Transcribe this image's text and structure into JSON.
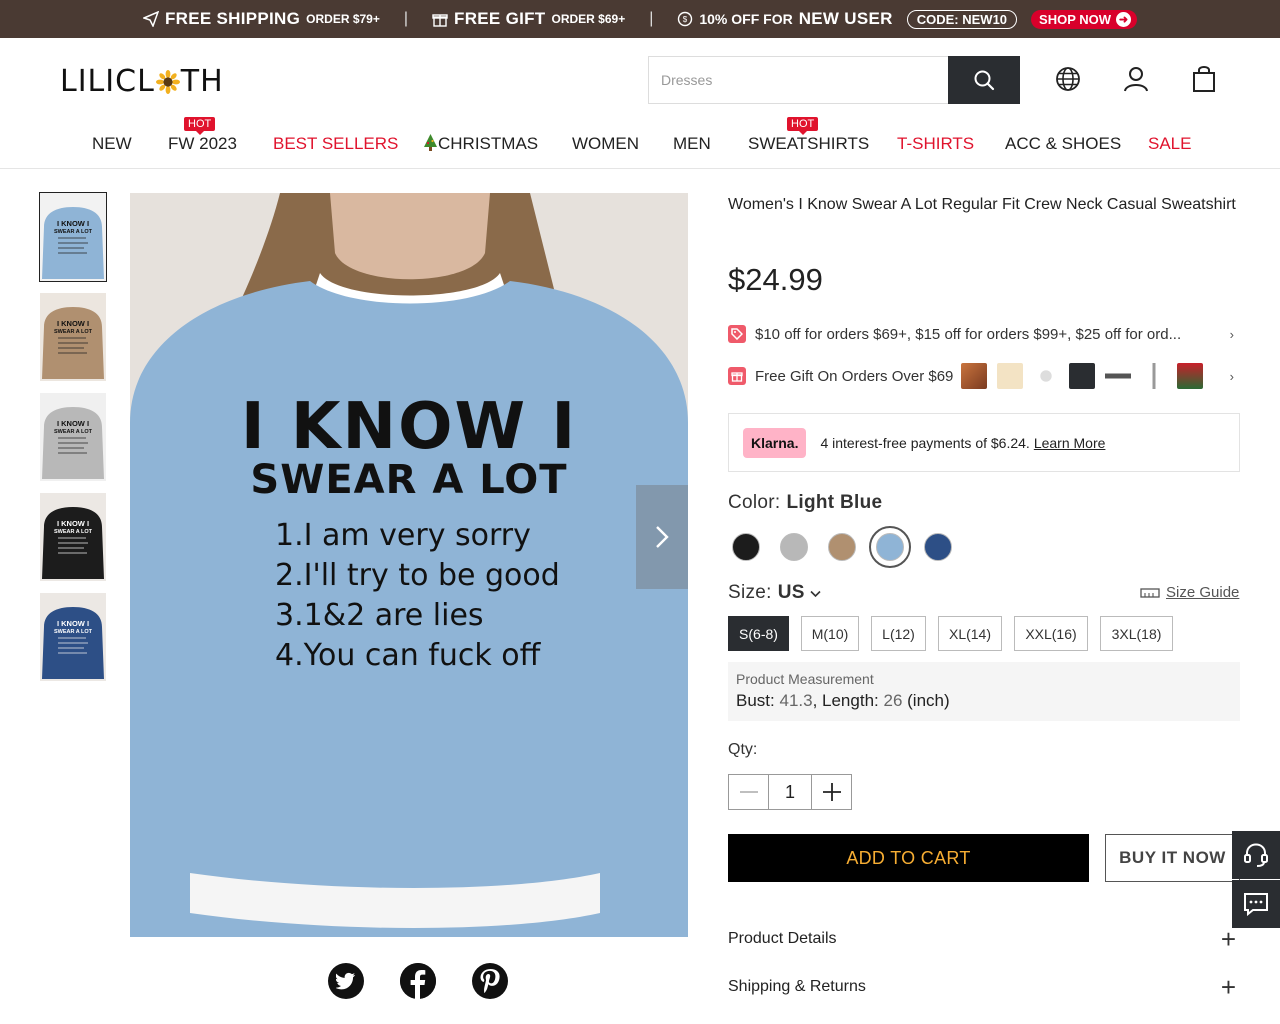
{
  "promo_bar": {
    "free_shipping": "FREE SHIPPING",
    "free_shipping_cond": "ORDER $79+",
    "free_gift": "FREE GIFT",
    "free_gift_cond": "ORDER $69+",
    "discount": "10% OFF FOR",
    "new_user": "NEW USER",
    "code": "CODE: NEW10",
    "shop_now": "SHOP NOW",
    "separator": "|"
  },
  "header": {
    "logo_left": "LILICL",
    "logo_right": "TH",
    "search_placeholder": "Dresses"
  },
  "nav": {
    "hot_badge": "HOT",
    "items": [
      "NEW",
      "FW 2023",
      "BEST SELLERS",
      "CHRISTMAS",
      "WOMEN",
      "MEN",
      "SWEATSHIRTS",
      "T-SHIRTS",
      "ACC & SHOES",
      "SALE"
    ]
  },
  "product": {
    "title": "Women's I Know Swear A Lot Regular Fit Crew Neck Casual Sweatshirt",
    "price": "$24.99",
    "promo_text": "$10 off for orders $69+, $15 off for orders $99+, $25 off for ord...",
    "gift_text": "Free Gift On Orders Over $69",
    "print_lines": [
      "I KNOW I",
      "SWEAR A LOT",
      "1.I am very sorry",
      "2.I'll try to be good",
      "3.1&2 are lies",
      "4.You can fuck off"
    ],
    "thumb_text": [
      "I KNOW I",
      "SWEAR A LOT"
    ]
  },
  "klarna": {
    "badge": "Klarna.",
    "text": "4 interest-free payments of $6.24.",
    "learn_more": "Learn More"
  },
  "color": {
    "label": "Color:",
    "selected": "Light Blue",
    "swatches": [
      {
        "name": "Black",
        "hex": "#1c1c1c"
      },
      {
        "name": "Gray",
        "hex": "#b8b8b8"
      },
      {
        "name": "Khaki",
        "hex": "#b09070"
      },
      {
        "name": "Light Blue",
        "hex": "#8fb4d6"
      },
      {
        "name": "Navy Blue",
        "hex": "#2d4f86"
      }
    ]
  },
  "size": {
    "label": "Size:",
    "system": "US",
    "guide": "Size Guide",
    "options": [
      "S(6-8)",
      "M(10)",
      "L(12)",
      "XL(14)",
      "XXL(16)",
      "3XL(18)"
    ],
    "selected": "S(6-8)"
  },
  "measurement": {
    "label": "Product Measurement",
    "bust_label": "Bust:",
    "bust": "41.3",
    "length_label": ", Length:",
    "length": "26",
    "unit": "(inch)"
  },
  "qty": {
    "label": "Qty:",
    "value": "1"
  },
  "buttons": {
    "add_to_cart": "ADD TO CART",
    "buy_now": "BUY IT NOW"
  },
  "accordions": [
    "Product Details",
    "Shipping & Returns"
  ],
  "colors": {
    "promo_bg": "#4a3a33",
    "accent_red": "#e0132d",
    "dark": "#2a2d31",
    "cart_text": "#f6ad33",
    "klarna_pink": "#ffb3c7"
  }
}
